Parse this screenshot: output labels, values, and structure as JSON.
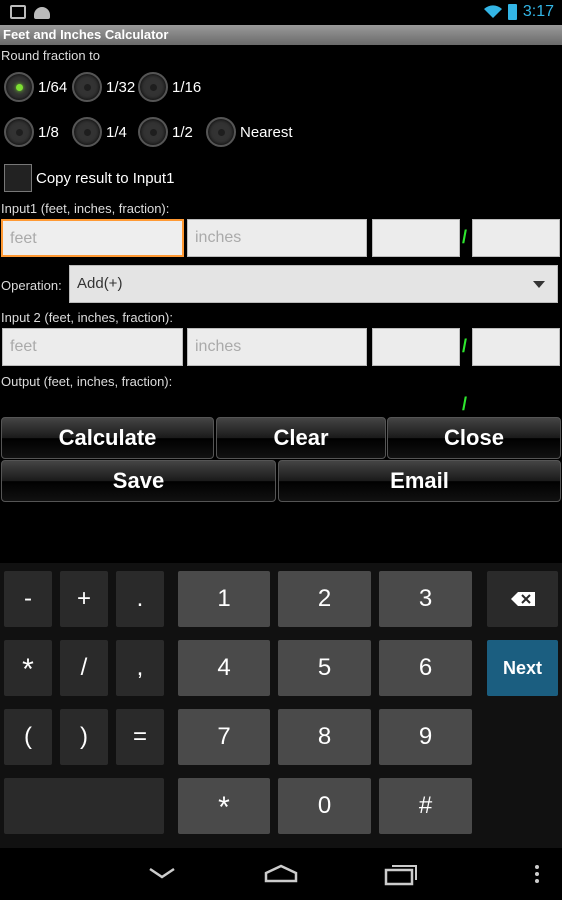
{
  "status_bar": {
    "time": "3:17"
  },
  "app": {
    "title": "Feet and Inches Calculator"
  },
  "round": {
    "label": "Round fraction to",
    "options": [
      {
        "label": "1/64",
        "selected": true
      },
      {
        "label": "1/32",
        "selected": false
      },
      {
        "label": "1/16",
        "selected": false
      },
      {
        "label": "1/8",
        "selected": false
      },
      {
        "label": "1/4",
        "selected": false
      },
      {
        "label": "1/2",
        "selected": false
      },
      {
        "label": "Nearest",
        "selected": false
      }
    ]
  },
  "copy_result": {
    "label": "Copy result to Input1",
    "checked": false
  },
  "input1": {
    "label": "Input1 (feet, inches, fraction):",
    "feet_placeholder": "feet",
    "inches_placeholder": "inches",
    "slash": "/"
  },
  "operation": {
    "label": "Operation:",
    "selected": "Add(+)"
  },
  "input2": {
    "label": "Input 2 (feet, inches, fraction):",
    "feet_placeholder": "feet",
    "inches_placeholder": "inches",
    "slash": "/"
  },
  "output": {
    "label": "Output (feet, inches, fraction):",
    "slash": "/"
  },
  "buttons": {
    "calculate": "Calculate",
    "clear": "Clear",
    "close": "Close",
    "save": "Save",
    "email": "Email"
  },
  "keyboard": {
    "keys": {
      "minus": "-",
      "plus": "+",
      "dot": ".",
      "one": "1",
      "two": "2",
      "three": "3",
      "star": "*",
      "slash": "/",
      "comma": ",",
      "four": "4",
      "five": "5",
      "six": "6",
      "lparen": "(",
      "rparen": ")",
      "equals": "=",
      "seven": "7",
      "eight": "8",
      "nine": "9",
      "star2": "*",
      "zero": "0",
      "hash": "#",
      "next": "Next"
    }
  },
  "colors": {
    "accent": "#33b5e5",
    "radio_on": "#7de033",
    "focus": "#ff9933",
    "slash": "#2ee62e"
  }
}
